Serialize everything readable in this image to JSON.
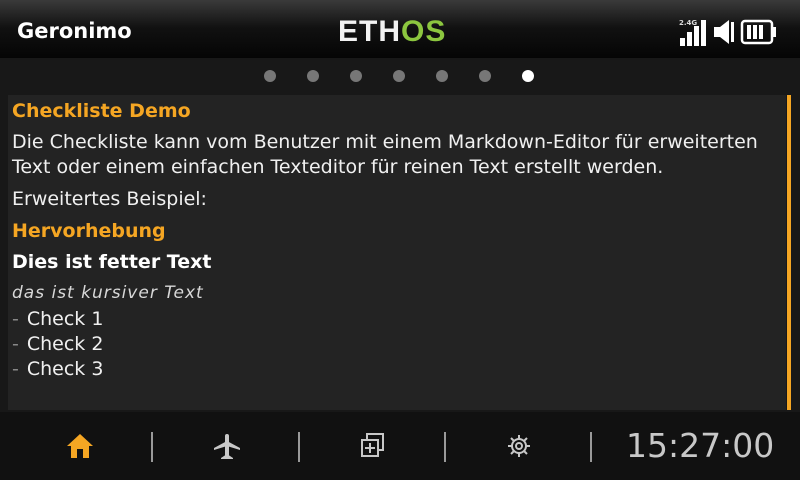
{
  "header": {
    "model_name": "Geronimo",
    "logo_left": "ETH",
    "logo_right": "OS",
    "rf_band": "2.4G",
    "icons": [
      "signal-bars-icon",
      "speaker-icon",
      "battery-icon"
    ]
  },
  "pager": {
    "count": 7,
    "active_index": 6
  },
  "content": {
    "title": "Checkliste Demo",
    "intro": "Die Checkliste kann vom Benutzer mit einem Markdown-Editor für erweiterten Text oder einem einfachen Texteditor für reinen Text erstellt werden.",
    "example_label": "Erweitertes Beispiel:",
    "emphasis_heading": "Hervorhebung",
    "bold_text": "Dies ist fetter Text",
    "italic_text": "das ist kursiver Text",
    "checks": [
      {
        "dash": "-",
        "label": "Check 1"
      },
      {
        "dash": "-",
        "label": "Check 2"
      },
      {
        "dash": "-",
        "label": "Check 3"
      }
    ]
  },
  "footer": {
    "tabs": [
      "home-icon",
      "airplane-icon",
      "add-window-icon",
      "gear-icon"
    ],
    "clock": "15:27:00"
  },
  "colors": {
    "accent": "#f5a623",
    "logo_green": "#8cc63f",
    "background": "#181818",
    "panel": "#232323"
  }
}
